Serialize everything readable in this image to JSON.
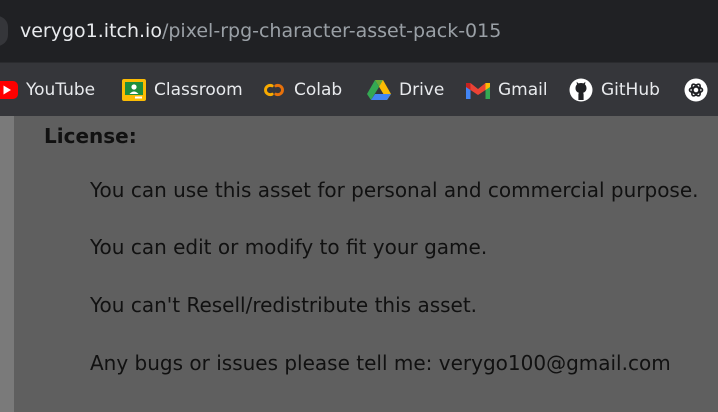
{
  "browser": {
    "url_host": "verygo1.itch.io",
    "url_path": "/pixel-rpg-character-asset-pack-015"
  },
  "bookmarks": [
    {
      "label": "YouTube",
      "icon": "youtube-icon",
      "color": "#ff0000"
    },
    {
      "label": "Classroom",
      "icon": "classroom-icon",
      "color": "#fbbc04"
    },
    {
      "label": "Colab",
      "icon": "colab-icon",
      "color": "#f9ab00"
    },
    {
      "label": "Drive",
      "icon": "drive-icon",
      "color": "#34a853"
    },
    {
      "label": "Gmail",
      "icon": "gmail-icon",
      "color": "#ea4335"
    },
    {
      "label": "GitHub",
      "icon": "github-icon",
      "color": "#ffffff"
    },
    {
      "label": "",
      "icon": "chatgpt-icon",
      "color": "#ffffff"
    }
  ],
  "license": {
    "heading": "License:",
    "lines": [
      "You can use this asset for personal and commercial purpose.",
      "You can edit or modify to fit your game.",
      "You can't Resell/redistribute this asset.",
      "Any bugs or issues please tell me: verygo100@gmail.com"
    ]
  }
}
